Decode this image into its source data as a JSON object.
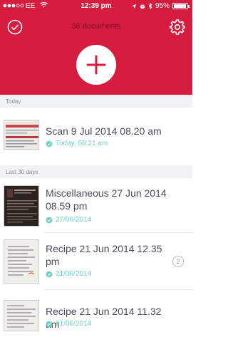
{
  "status_bar": {
    "carrier": "EE",
    "time": "12:39 pm",
    "battery": "95%",
    "battery_level": 0.95,
    "signal_icon": "signal-dots-icon",
    "wifi_icon": "wifi-icon"
  },
  "header": {
    "doc_count": "36 documents",
    "bg_color": "#d51c3e",
    "select_icon": "check-circle-icon",
    "settings_icon": "gear-icon",
    "add_icon": "plus-icon"
  },
  "sections": [
    {
      "title": "Today",
      "items": [
        {
          "title": "Scan 9 Jul 2014 08.20 am",
          "date": "Today, 08:21 am",
          "thumb": "receipt"
        }
      ]
    },
    {
      "title": "Last 30 days",
      "items": [
        {
          "title": "Miscellaneous 27 Jun 2014 08.59 pm",
          "date": "27/06/2014",
          "thumb": "dark"
        },
        {
          "title": "Recipe 21 Jun 2014 12.35 pm",
          "date": "21/06/2014",
          "thumb": "paper",
          "pages": "2"
        },
        {
          "title": "Recipe 21 Jun 2014 11.32 am",
          "date": "21/06/2014",
          "thumb": "paper2"
        }
      ]
    }
  ],
  "accent_color": "#6fcfc6"
}
